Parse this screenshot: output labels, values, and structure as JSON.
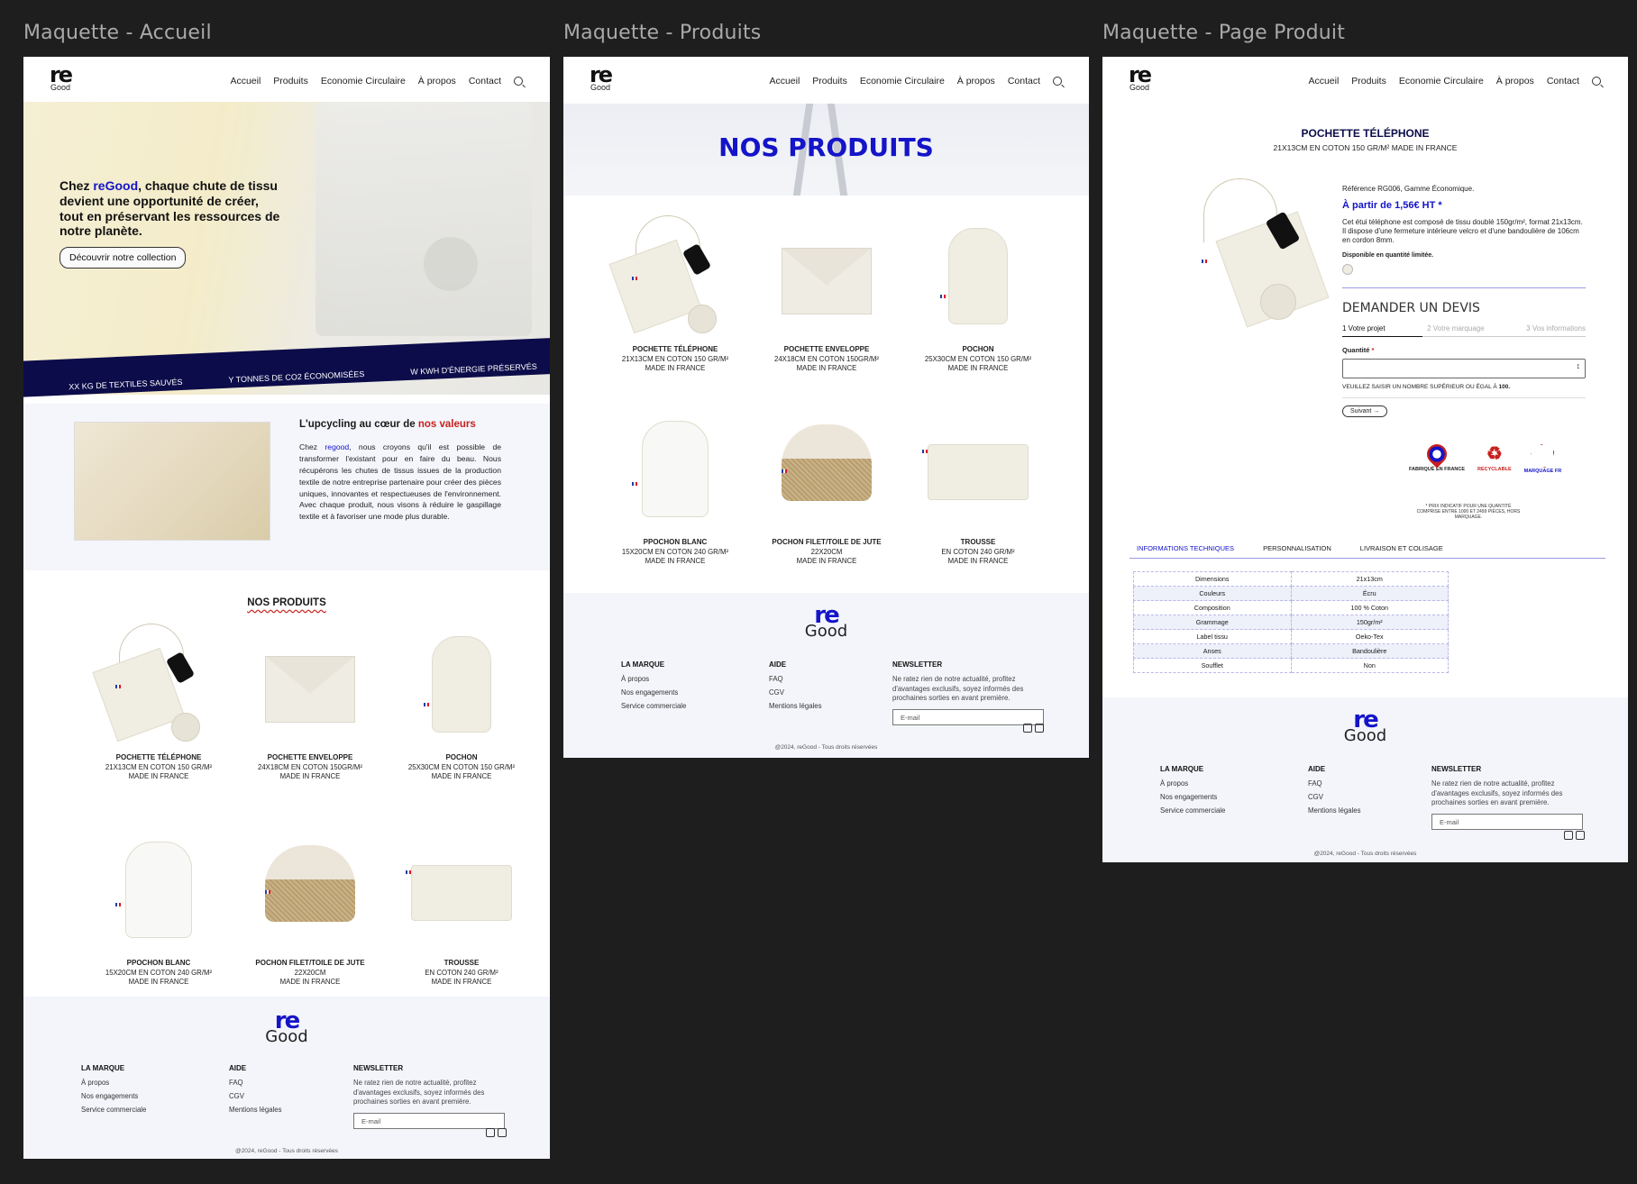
{
  "frames": {
    "home_title": "Maquette - Accueil",
    "products_title": "Maquette - Produits",
    "product_page_title": "Maquette - Page Produit"
  },
  "brand": {
    "logo_re": "re",
    "logo_good": "Good"
  },
  "nav": {
    "items": [
      "Accueil",
      "Produits",
      "Economie Circulaire",
      "À propos",
      "Contact"
    ]
  },
  "home": {
    "hero_prefix": "Chez ",
    "hero_brand": "reGood",
    "hero_text": ", chaque chute de tissu devient une opportunité de créer, tout en préservant les ressources de notre planète.",
    "hero_button": "Découvrir notre collection",
    "stats": [
      "XX KG DE TEXTILES SAUVÉS",
      "Y TONNES DE CO2  ÉCONOMISÉES",
      "W KWH D'ÉNERGIE PRÉSERVÉS"
    ],
    "values_title_prefix": "L'upcycling au cœur de ",
    "values_title_accent": "nos valeurs",
    "values_p_prefix": "Chez ",
    "values_p_brand": "regood",
    "values_p_text": ", nous croyons qu'il est possible de transformer l'existant pour en faire du beau. Nous récupérons les chutes de tissus issues de la production textile de notre entreprise partenaire pour créer des pièces uniques, innovantes et respectueuses de l'environnement. Avec chaque produit, nous visons à réduire le gaspillage textile et à favoriser une mode plus durable.",
    "products_heading": "NOS PRODUITS"
  },
  "products_heading": "NOS PRODUITS",
  "products": [
    {
      "name": "POCHETTE TÉLÉPHONE",
      "l1": "21X13CM EN COTON 150 GR/M²",
      "l2": "MADE IN FRANCE"
    },
    {
      "name": "POCHETTE ENVELOPPE",
      "l1": "24X18CM EN COTON 150GR/M²",
      "l2": "MADE IN FRANCE"
    },
    {
      "name": "POCHON",
      "l1": "25X30CM EN COTON 150 GR/M²",
      "l2": "MADE IN FRANCE"
    },
    {
      "name": "PPOCHON BLANC",
      "l1": "15X20CM EN COTON 240 GR/M²",
      "l2": "MADE IN FRANCE"
    },
    {
      "name": "POCHON FILET/TOILE DE JUTE",
      "l1": "22X20CM",
      "l2": "MADE IN FRANCE"
    },
    {
      "name": "TROUSSE",
      "l1": "EN COTON 240 GR/M²",
      "l2": "MADE IN FRANCE"
    }
  ],
  "footer": {
    "col1_title": "LA MARQUE",
    "col1_links": [
      "À propos",
      "Nos engagements",
      "Service commerciale"
    ],
    "col2_title": "AIDE",
    "col2_links": [
      "FAQ",
      "CGV",
      "Mentions légales"
    ],
    "col3_title": "NEWSLETTER",
    "col3_text": "Ne ratez rien de notre actualité, profitez d'avantages exclusifs, soyez informés des prochaines sorties en avant première.",
    "email_placeholder": "E-mail",
    "copyright": "@2024, reGood - Tous droits réservées"
  },
  "product_page": {
    "title": "POCHETTE TÉLÉPHONE",
    "subtitle": "21X13CM EN COTON 150 GR/M² MADE IN FRANCE",
    "reference": "Référence RG006, Gamme Économique.",
    "price": "À partir de 1,56€ HT *",
    "description": "Cet étui téléphone est composé de tissu doublé 150gr/m², format 21x13cm. Il dispose d'une fermeture intérieure velcro et d'une bandoulière de 106cm en cordon 8mm.",
    "availability": "Disponible en quantité limitée.",
    "quote_title": "DEMANDER UN DEVIS",
    "steps": [
      "1 Votre projet",
      "2 Votre marquage",
      "3 Vos informations"
    ],
    "quantity_label": "Quantité",
    "quantity_required": "*",
    "quantity_hint_prefix": "VEUILLEZ SAISIR UN NOMBRE SUPÉRIEUR OU ÉGAL À ",
    "quantity_hint_value": "100.",
    "next_button": "Suivant",
    "badges": [
      "FABRIQUÉ EN FRANCE",
      "RECYCLABLE",
      "MARQUAGE FR"
    ],
    "footnote": "* PRIX INDICATIF POUR UNE QUANTITÉ COMPRISE ENTRE 1000 ET 2499 PIÈCES, HORS MARQUAGE.",
    "tabs": [
      "INFORMATIONS TECHNIQUES",
      "PERSONNALISATION",
      "LIVRAISON ET COLISAGE"
    ],
    "specs": [
      [
        "Dimensions",
        "21x13cm"
      ],
      [
        "Couleurs",
        "Écru"
      ],
      [
        "Composition",
        "100 % Coton"
      ],
      [
        "Grammage",
        "150gr/m²"
      ],
      [
        "Label tissu",
        "Oeko-Tex"
      ],
      [
        "Anses",
        "Bandoulière"
      ],
      [
        "Soufflet",
        "Non"
      ]
    ]
  },
  "colors": {
    "accent": "#1414c8",
    "red": "#c8201e",
    "navy": "#0c0c4a",
    "footer_bg": "#f3f5fb"
  }
}
